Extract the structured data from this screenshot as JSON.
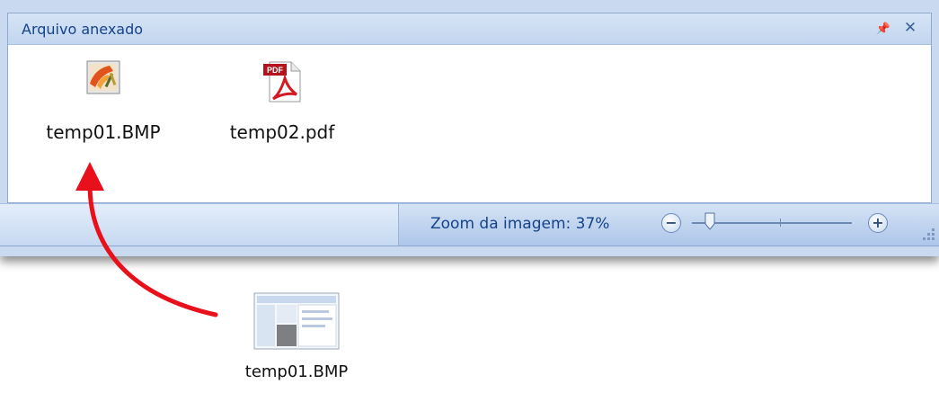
{
  "panel": {
    "title": "Arquivo anexado",
    "pin_icon": "pin-icon",
    "close_icon": "close-icon"
  },
  "attachments": [
    {
      "name": "temp01.BMP",
      "icon": "bitmap-image-icon"
    },
    {
      "name": "temp02.pdf",
      "icon": "pdf-document-icon"
    }
  ],
  "statusbar": {
    "zoom_label": "Zoom da imagem:",
    "zoom_value": "37%",
    "zoom_out_icon": "zoom-out-icon",
    "zoom_in_icon": "zoom-in-icon",
    "zoom_fraction": 0.37
  },
  "desktop": {
    "file_name": "temp01.BMP",
    "file_icon": "bmp-thumbnail-icon"
  },
  "colors": {
    "header_text": "#15428b",
    "arrow": "#e8101a"
  }
}
